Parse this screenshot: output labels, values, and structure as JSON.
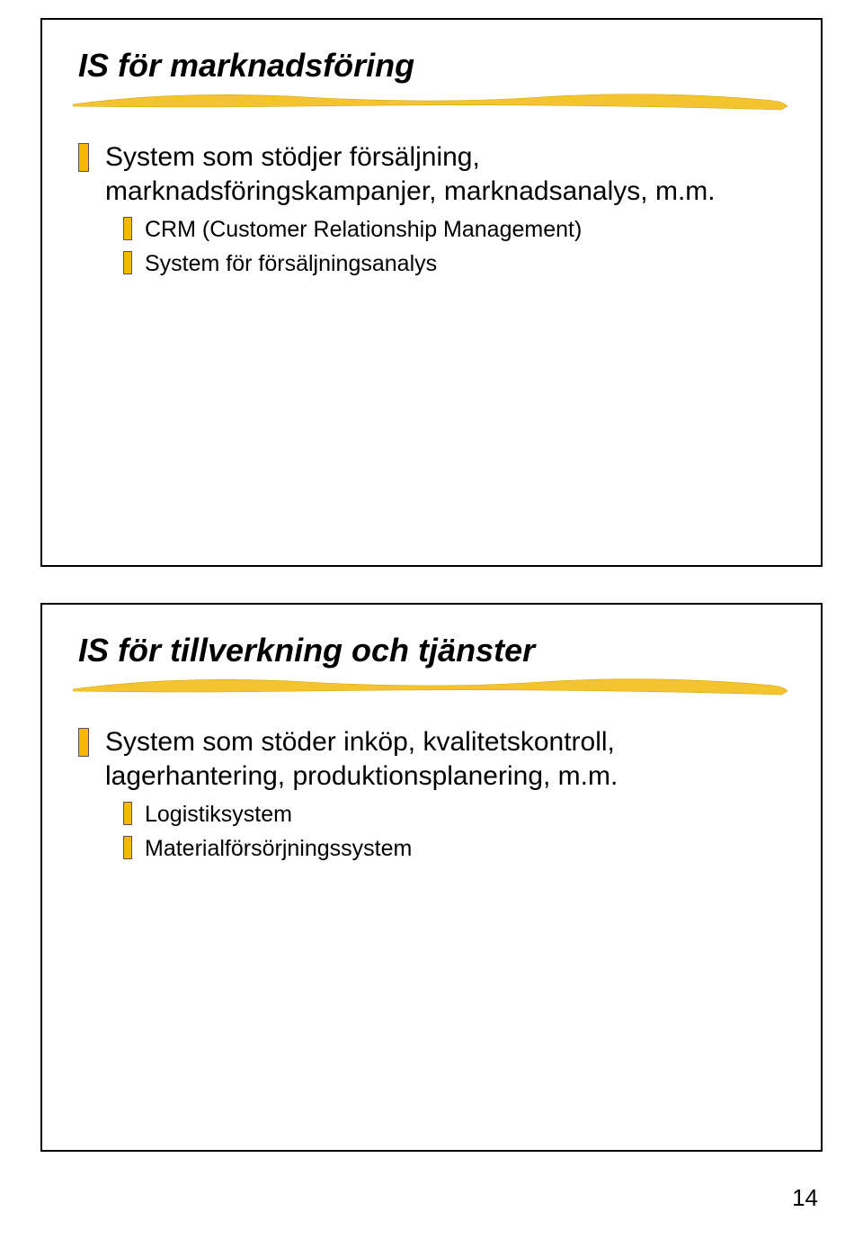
{
  "slides": [
    {
      "title": "IS för marknadsföring",
      "l1": "System som stödjer försäljning, marknadsföringskampanjer, marknadsanalys, m.m.",
      "l2a": "CRM (Customer Relationship Management)",
      "l2b": "System för försäljningsanalys"
    },
    {
      "title": "IS för tillverkning och tjänster",
      "l1": "System som stöder inköp, kvalitetskontroll, lagerhantering, produktionsplanering, m.m.",
      "l2a": "Logistiksystem",
      "l2b": "Materialförsörjningssystem"
    }
  ],
  "page_number": "14"
}
